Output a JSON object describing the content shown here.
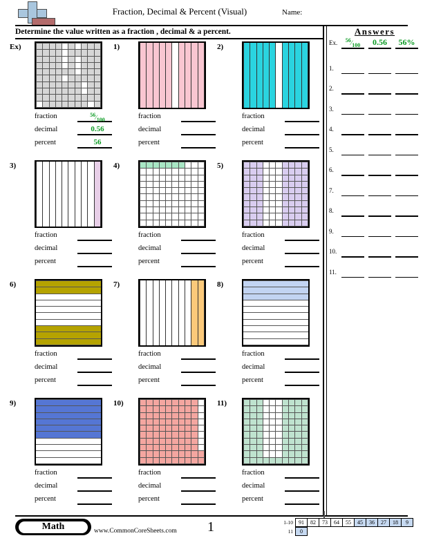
{
  "header": {
    "title": "Fraction, Decimal & Percent (Visual)",
    "name_label": "Name:",
    "instructions": "Determine the value written as a fraction , decimal & a percent.",
    "logo_name": "math-plus-logo"
  },
  "labels": {
    "fraction": "fraction",
    "decimal": "decimal",
    "percent": "percent"
  },
  "example": {
    "number": "Ex)",
    "fraction_num": "56",
    "fraction_den": "100",
    "decimal": "0.56",
    "percent": "56",
    "answer_percent": "56%"
  },
  "answers_panel": {
    "title": "Answers",
    "example_index": "Ex.",
    "rows": [
      "1.",
      "2.",
      "3.",
      "4.",
      "5.",
      "6.",
      "7.",
      "8.",
      "9.",
      "10.",
      "11."
    ]
  },
  "problems": [
    {
      "number": "1)",
      "grid": "cols",
      "total": 10,
      "shaded": 9,
      "color": "#f9c6d1",
      "pattern": [
        1,
        1,
        1,
        1,
        1,
        0,
        1,
        1,
        1,
        1
      ]
    },
    {
      "number": "2)",
      "grid": "cols",
      "total": 10,
      "shaded": 9,
      "color": "#2ad4e0",
      "pattern": [
        1,
        1,
        1,
        1,
        1,
        0,
        1,
        1,
        1,
        1
      ]
    },
    {
      "number": "3)",
      "grid": "cols",
      "total": 10,
      "shaded": 1,
      "color": "#e8cfe8",
      "pattern": [
        0,
        0,
        0,
        0,
        0,
        0,
        0,
        0,
        0,
        1
      ]
    },
    {
      "number": "4)",
      "grid": "cells",
      "total": 100,
      "shaded": 7,
      "color": "#a8e6c4",
      "pattern": [
        [
          1,
          1,
          1,
          1,
          1,
          1,
          1,
          0,
          0,
          0
        ],
        [
          0,
          0,
          0,
          0,
          0,
          0,
          0,
          0,
          0,
          0
        ],
        [
          0,
          0,
          0,
          0,
          0,
          0,
          0,
          0,
          0,
          0
        ],
        [
          0,
          0,
          0,
          0,
          0,
          0,
          0,
          0,
          0,
          0
        ],
        [
          0,
          0,
          0,
          0,
          0,
          0,
          0,
          0,
          0,
          0
        ],
        [
          0,
          0,
          0,
          0,
          0,
          0,
          0,
          0,
          0,
          0
        ],
        [
          0,
          0,
          0,
          0,
          0,
          0,
          0,
          0,
          0,
          0
        ],
        [
          0,
          0,
          0,
          0,
          0,
          0,
          0,
          0,
          0,
          0
        ],
        [
          0,
          0,
          0,
          0,
          0,
          0,
          0,
          0,
          0,
          0
        ],
        [
          0,
          0,
          0,
          0,
          0,
          0,
          0,
          0,
          0,
          0
        ]
      ]
    },
    {
      "number": "5)",
      "grid": "cells",
      "total": 100,
      "shaded": 70,
      "color": "#d9cdf0",
      "pattern": [
        [
          1,
          1,
          1,
          0,
          0,
          0,
          1,
          1,
          1,
          1
        ],
        [
          1,
          1,
          1,
          0,
          0,
          0,
          1,
          1,
          1,
          1
        ],
        [
          1,
          1,
          1,
          0,
          0,
          0,
          1,
          1,
          1,
          1
        ],
        [
          1,
          1,
          1,
          0,
          0,
          0,
          1,
          1,
          1,
          1
        ],
        [
          1,
          1,
          1,
          0,
          0,
          0,
          1,
          1,
          1,
          1
        ],
        [
          1,
          1,
          1,
          0,
          0,
          0,
          1,
          1,
          1,
          1
        ],
        [
          1,
          1,
          1,
          0,
          0,
          0,
          1,
          1,
          1,
          1
        ],
        [
          1,
          1,
          1,
          0,
          0,
          0,
          1,
          1,
          1,
          1
        ],
        [
          1,
          1,
          1,
          0,
          0,
          0,
          1,
          1,
          1,
          1
        ],
        [
          1,
          1,
          1,
          0,
          0,
          0,
          1,
          1,
          1,
          1
        ]
      ]
    },
    {
      "number": "6)",
      "grid": "rows",
      "total": 10,
      "shaded": 5,
      "color": "#b5a300",
      "pattern": [
        1,
        1,
        0,
        0,
        0,
        0,
        0,
        1,
        1,
        1
      ]
    },
    {
      "number": "7)",
      "grid": "cols",
      "total": 10,
      "shaded": 2,
      "color": "#fbc97a",
      "pattern": [
        0,
        0,
        0,
        0,
        0,
        0,
        0,
        0,
        1,
        1
      ]
    },
    {
      "number": "8)",
      "grid": "rows",
      "total": 10,
      "shaded": 3,
      "color": "#c2d4f2",
      "pattern": [
        1,
        1,
        1,
        0,
        0,
        0,
        0,
        0,
        0,
        0
      ]
    },
    {
      "number": "9)",
      "grid": "rows",
      "total": 10,
      "shaded": 6,
      "color": "#5576d4",
      "pattern": [
        1,
        1,
        1,
        1,
        1,
        1,
        0,
        0,
        0,
        0
      ]
    },
    {
      "number": "10)",
      "grid": "cells",
      "total": 100,
      "shaded": 92,
      "color": "#f4a6a0",
      "pattern": [
        [
          1,
          1,
          1,
          1,
          1,
          1,
          1,
          1,
          1,
          0
        ],
        [
          1,
          1,
          1,
          1,
          1,
          1,
          1,
          1,
          1,
          0
        ],
        [
          1,
          1,
          1,
          1,
          1,
          1,
          1,
          1,
          1,
          0
        ],
        [
          1,
          1,
          1,
          1,
          1,
          1,
          1,
          1,
          1,
          0
        ],
        [
          1,
          1,
          1,
          1,
          1,
          1,
          1,
          1,
          1,
          0
        ],
        [
          1,
          1,
          1,
          1,
          1,
          1,
          1,
          1,
          1,
          0
        ],
        [
          1,
          1,
          1,
          1,
          1,
          1,
          1,
          1,
          1,
          0
        ],
        [
          1,
          1,
          1,
          1,
          1,
          1,
          1,
          1,
          1,
          0
        ],
        [
          1,
          1,
          1,
          1,
          1,
          1,
          1,
          1,
          1,
          1
        ],
        [
          1,
          1,
          1,
          1,
          1,
          1,
          1,
          1,
          1,
          1
        ]
      ]
    },
    {
      "number": "11)",
      "grid": "cells",
      "total": 100,
      "shaded": 73,
      "color": "#bfe3cf",
      "pattern": [
        [
          1,
          1,
          1,
          0,
          0,
          0,
          1,
          1,
          1,
          1
        ],
        [
          1,
          1,
          1,
          0,
          0,
          0,
          1,
          1,
          1,
          1
        ],
        [
          1,
          1,
          1,
          0,
          0,
          0,
          1,
          1,
          1,
          1
        ],
        [
          1,
          1,
          1,
          0,
          0,
          0,
          1,
          1,
          1,
          1
        ],
        [
          1,
          1,
          1,
          0,
          0,
          0,
          1,
          1,
          1,
          1
        ],
        [
          1,
          1,
          1,
          0,
          0,
          0,
          1,
          1,
          1,
          1
        ],
        [
          1,
          1,
          1,
          0,
          0,
          0,
          1,
          1,
          1,
          1
        ],
        [
          1,
          1,
          1,
          0,
          0,
          0,
          1,
          1,
          1,
          1
        ],
        [
          1,
          1,
          1,
          0,
          0,
          0,
          1,
          1,
          1,
          1
        ],
        [
          1,
          1,
          1,
          1,
          1,
          1,
          1,
          1,
          1,
          1
        ]
      ]
    }
  ],
  "example_grid": {
    "grid": "cells",
    "total": 100,
    "shaded": 56,
    "color": "#d6d6d6",
    "pattern": [
      [
        1,
        1,
        1,
        1,
        0,
        1,
        0,
        1,
        1,
        1
      ],
      [
        1,
        1,
        1,
        1,
        0,
        1,
        1,
        1,
        1,
        1
      ],
      [
        1,
        1,
        1,
        1,
        0,
        1,
        0,
        1,
        1,
        1
      ],
      [
        1,
        1,
        1,
        1,
        0,
        1,
        0,
        1,
        1,
        1
      ],
      [
        1,
        1,
        1,
        1,
        1,
        1,
        0,
        1,
        1,
        1
      ],
      [
        1,
        1,
        1,
        1,
        0,
        1,
        1,
        1,
        1,
        1
      ],
      [
        1,
        1,
        1,
        1,
        1,
        1,
        1,
        0,
        1,
        1
      ],
      [
        1,
        1,
        1,
        1,
        1,
        1,
        1,
        0,
        1,
        1
      ],
      [
        1,
        1,
        1,
        1,
        1,
        1,
        1,
        1,
        1,
        1
      ],
      [
        0,
        1,
        1,
        1,
        1,
        1,
        1,
        1,
        0,
        1
      ]
    ]
  },
  "footer": {
    "badge": "Math",
    "site": "www.CommonCoreSheets.com",
    "page_number": "1",
    "scale_row1_label": "1-10",
    "scale_row2_label": "11",
    "scale_row1": [
      "91",
      "82",
      "73",
      "64",
      "55",
      "45",
      "36",
      "27",
      "18",
      "9"
    ],
    "scale_row1_highlight": [
      false,
      false,
      false,
      false,
      false,
      true,
      true,
      true,
      true,
      true
    ],
    "scale_row2": [
      "0"
    ],
    "scale_row2_highlight": [
      true
    ]
  }
}
